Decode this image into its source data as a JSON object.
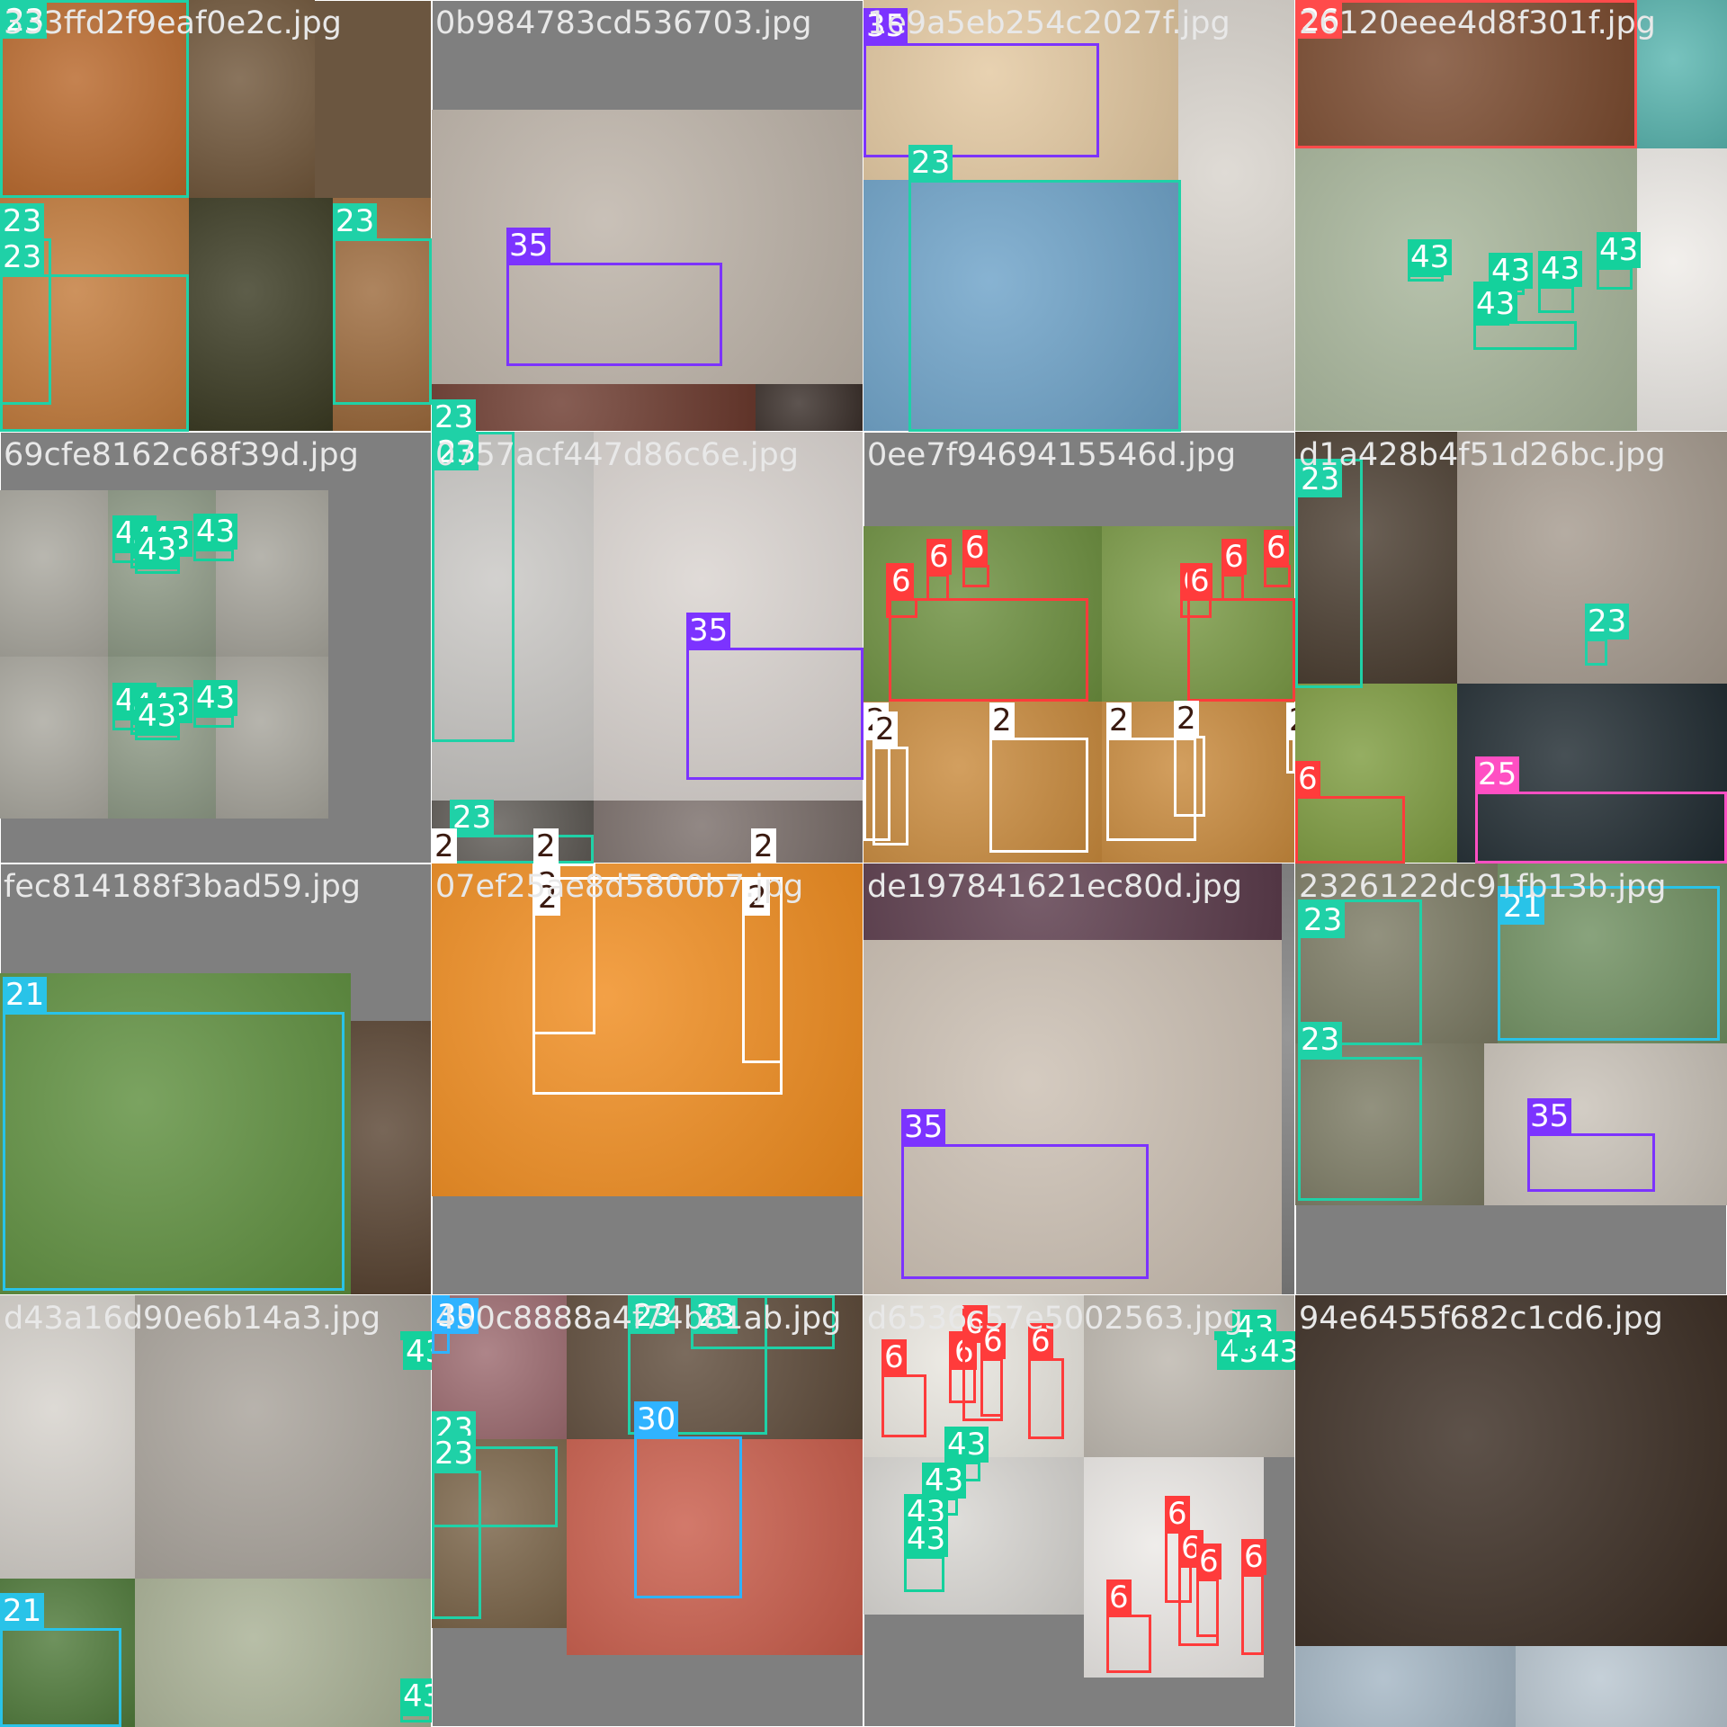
{
  "grid": {
    "rows": 4,
    "cols": 4
  },
  "class_colors": {
    "2": "#ffffff",
    "6": "#ff3b3b",
    "21": "#29c3e8",
    "23": "#1fd1a7",
    "25": "#ff4fc3",
    "26": "#ff4b4b",
    "30": "#2fb3ff",
    "35": "#7c33ff",
    "43": "#14d19c"
  },
  "tag_text_colors": {
    "2": "#3a1a10"
  },
  "tiles": [
    {
      "name": "333ffd2f9eaf0e2c.jpg",
      "bg": "#6b5640",
      "photos": [
        {
          "l": 0,
          "t": 0,
          "w": 210,
          "h": 220,
          "bg": "#b8672a"
        },
        {
          "l": 210,
          "t": 0,
          "w": 140,
          "h": 220,
          "bg": "#70563a"
        },
        {
          "l": 0,
          "t": 220,
          "w": 210,
          "h": 260,
          "bg": "#c27a3a"
        },
        {
          "l": 210,
          "t": 220,
          "w": 160,
          "h": 260,
          "bg": "#3a3a22"
        },
        {
          "l": 370,
          "t": 220,
          "w": 110,
          "h": 260,
          "bg": "#9c6a3c"
        }
      ],
      "boxes": [
        {
          "c": "23",
          "l": 0,
          "t": 0,
          "w": 210,
          "h": 220
        },
        {
          "c": "23",
          "l": 0,
          "t": 265,
          "w": 57,
          "h": 185
        },
        {
          "c": "23",
          "l": 0,
          "t": 305,
          "w": 210,
          "h": 175
        },
        {
          "c": "23",
          "l": 370,
          "t": 265,
          "w": 110,
          "h": 185
        }
      ]
    },
    {
      "name": "0b984783cd536703.jpg",
      "bg": "#7f7f7f",
      "photos": [
        {
          "l": 0,
          "t": 122,
          "w": 480,
          "h": 305,
          "bg": "#bdb3a8"
        },
        {
          "l": 0,
          "t": 427,
          "w": 360,
          "h": 53,
          "bg": "#6c3a2e"
        },
        {
          "l": 360,
          "t": 427,
          "w": 120,
          "h": 53,
          "bg": "#3a2f2a"
        }
      ],
      "boxes": [
        {
          "c": "35",
          "l": 83,
          "t": 292,
          "w": 240,
          "h": 115
        },
        {
          "c": "23",
          "l": 0,
          "t": 483,
          "w": 5,
          "h": 5
        }
      ]
    },
    {
      "name": "1e9a5eb254c2027f.jpg",
      "bg": "#d7d0c6",
      "photos": [
        {
          "l": 0,
          "t": 0,
          "w": 350,
          "h": 200,
          "bg": "#e3c8a0"
        },
        {
          "l": 0,
          "t": 200,
          "w": 350,
          "h": 280,
          "bg": "#6da2c8"
        },
        {
          "l": 350,
          "t": 0,
          "w": 130,
          "h": 480,
          "bg": "#d8d3cc"
        }
      ],
      "boxes": [
        {
          "c": "35",
          "l": 0,
          "t": 48,
          "w": 262,
          "h": 127
        },
        {
          "c": "23",
          "l": 50,
          "t": 200,
          "w": 303,
          "h": 280
        }
      ]
    },
    {
      "name": "26120eee4d8f301f.jpg",
      "bg": "#c9b7a0",
      "photos": [
        {
          "l": 0,
          "t": 0,
          "w": 380,
          "h": 165,
          "bg": "#7a4a2e"
        },
        {
          "l": 380,
          "t": 0,
          "w": 100,
          "h": 165,
          "bg": "#5ab6b0"
        },
        {
          "l": 0,
          "t": 165,
          "w": 380,
          "h": 315,
          "bg": "#a7b59a"
        },
        {
          "l": 380,
          "t": 165,
          "w": 100,
          "h": 315,
          "bg": "#efece8"
        }
      ],
      "boxes": [
        {
          "c": "26",
          "l": 0,
          "t": 0,
          "w": 380,
          "h": 165
        },
        {
          "c": "43",
          "l": 125,
          "t": 305,
          "w": 40,
          "h": 8
        },
        {
          "c": "43",
          "l": 215,
          "t": 320,
          "w": 40,
          "h": 8
        },
        {
          "c": "43",
          "l": 270,
          "t": 318,
          "w": 40,
          "h": 30
        },
        {
          "c": "43",
          "l": 335,
          "t": 297,
          "w": 40,
          "h": 25
        },
        {
          "c": "43",
          "l": 198,
          "t": 352,
          "w": 40,
          "h": 10
        },
        {
          "c": "43",
          "l": 198,
          "t": 357,
          "w": 115,
          "h": 32
        }
      ]
    },
    {
      "name": "69cfe8162c68f39d.jpg",
      "bg": "#7f7f7f",
      "photos": [
        {
          "l": 0,
          "t": 65,
          "w": 120,
          "h": 185,
          "bg": "#a9a79e"
        },
        {
          "l": 120,
          "t": 65,
          "w": 120,
          "h": 185,
          "bg": "#8e9a86"
        },
        {
          "l": 240,
          "t": 65,
          "w": 125,
          "h": 185,
          "bg": "#a6a49b"
        },
        {
          "l": 0,
          "t": 250,
          "w": 120,
          "h": 180,
          "bg": "#a9a79e"
        },
        {
          "l": 120,
          "t": 250,
          "w": 120,
          "h": 180,
          "bg": "#8e9a86"
        },
        {
          "l": 240,
          "t": 250,
          "w": 125,
          "h": 180,
          "bg": "#a6a49b"
        }
      ],
      "boxes": [
        {
          "c": "43",
          "l": 125,
          "t": 132,
          "w": 35,
          "h": 14
        },
        {
          "c": "43",
          "l": 145,
          "t": 138,
          "w": 35,
          "h": 14
        },
        {
          "c": "43",
          "l": 165,
          "t": 138,
          "w": 35,
          "h": 14
        },
        {
          "c": "43",
          "l": 150,
          "t": 150,
          "w": 50,
          "h": 8
        },
        {
          "c": "43",
          "l": 215,
          "t": 130,
          "w": 45,
          "h": 14
        },
        {
          "c": "43",
          "l": 125,
          "t": 318,
          "w": 35,
          "h": 14
        },
        {
          "c": "43",
          "l": 145,
          "t": 323,
          "w": 35,
          "h": 14
        },
        {
          "c": "43",
          "l": 165,
          "t": 323,
          "w": 35,
          "h": 14
        },
        {
          "c": "43",
          "l": 150,
          "t": 335,
          "w": 50,
          "h": 8
        },
        {
          "c": "43",
          "l": 215,
          "t": 315,
          "w": 45,
          "h": 14
        }
      ]
    },
    {
      "name": "0757acf447d86c6e.jpg",
      "bg": "#bbb8b4",
      "photos": [
        {
          "l": 0,
          "t": 0,
          "w": 180,
          "h": 410,
          "bg": "#c9c7c4"
        },
        {
          "l": 180,
          "t": 0,
          "w": 300,
          "h": 410,
          "bg": "#d9d3cf"
        },
        {
          "l": 0,
          "t": 410,
          "w": 180,
          "h": 70,
          "bg": "#5e5a55"
        },
        {
          "l": 180,
          "t": 410,
          "w": 300,
          "h": 70,
          "bg": "#7a6e6a"
        }
      ],
      "boxes": [
        {
          "c": "23",
          "l": 0,
          "t": 0,
          "w": 92,
          "h": 345
        },
        {
          "c": "35",
          "l": 283,
          "t": 240,
          "w": 197,
          "h": 147
        },
        {
          "c": "23",
          "l": 20,
          "t": 448,
          "w": 160,
          "h": 32
        },
        {
          "c": "2",
          "l": 0,
          "t": 480,
          "w": 5,
          "h": 5
        },
        {
          "c": "2",
          "l": 113,
          "t": 480,
          "w": 5,
          "h": 5
        },
        {
          "c": "2",
          "l": 355,
          "t": 480,
          "w": 5,
          "h": 5
        }
      ]
    },
    {
      "name": "0ee7f9469415546d.jpg",
      "bg": "#7f7f7f",
      "photos": [
        {
          "l": 0,
          "t": 105,
          "w": 265,
          "h": 195,
          "bg": "#6c8f3e"
        },
        {
          "l": 265,
          "t": 105,
          "w": 215,
          "h": 195,
          "bg": "#7a9a45"
        },
        {
          "l": 0,
          "t": 300,
          "w": 265,
          "h": 180,
          "bg": "#c98a3c"
        },
        {
          "l": 265,
          "t": 300,
          "w": 215,
          "h": 180,
          "bg": "#c98a3c"
        }
      ],
      "boxes": [
        {
          "c": "6",
          "l": 25,
          "t": 185,
          "w": 35,
          "h": 22
        },
        {
          "c": "6",
          "l": 70,
          "t": 158,
          "w": 25,
          "h": 30
        },
        {
          "c": "6",
          "l": 110,
          "t": 148,
          "w": 30,
          "h": 25
        },
        {
          "c": "6",
          "l": 28,
          "t": 185,
          "w": 222,
          "h": 115
        },
        {
          "c": "6",
          "l": 352,
          "t": 185,
          "w": 35,
          "h": 22
        },
        {
          "c": "6",
          "l": 398,
          "t": 158,
          "w": 25,
          "h": 30
        },
        {
          "c": "6",
          "l": 445,
          "t": 148,
          "w": 30,
          "h": 25
        },
        {
          "c": "6",
          "l": 360,
          "t": 185,
          "w": 120,
          "h": 115
        },
        {
          "c": "2",
          "l": 0,
          "t": 340,
          "w": 30,
          "h": 115
        },
        {
          "c": "2",
          "l": 10,
          "t": 350,
          "w": 40,
          "h": 110
        },
        {
          "c": "2",
          "l": 140,
          "t": 340,
          "w": 110,
          "h": 128
        },
        {
          "c": "2",
          "l": 270,
          "t": 340,
          "w": 100,
          "h": 115
        },
        {
          "c": "2",
          "l": 345,
          "t": 338,
          "w": 35,
          "h": 90
        },
        {
          "c": "2",
          "l": 470,
          "t": 340,
          "w": 10,
          "h": 40
        }
      ]
    },
    {
      "name": "d1a428b4f51d26bc.jpg",
      "bg": "#3a3a3a",
      "photos": [
        {
          "l": 0,
          "t": 0,
          "w": 180,
          "h": 280,
          "bg": "#4a3d30"
        },
        {
          "l": 180,
          "t": 0,
          "w": 300,
          "h": 280,
          "bg": "#a59a8e"
        },
        {
          "l": 0,
          "t": 280,
          "w": 180,
          "h": 200,
          "bg": "#7e9c40"
        },
        {
          "l": 180,
          "t": 280,
          "w": 300,
          "h": 200,
          "bg": "#1f2a30"
        }
      ],
      "boxes": [
        {
          "c": "23",
          "l": 0,
          "t": 30,
          "w": 75,
          "h": 255
        },
        {
          "c": "23",
          "l": 322,
          "t": 230,
          "w": 25,
          "h": 30
        },
        {
          "c": "6",
          "l": 0,
          "t": 405,
          "w": 122,
          "h": 75
        },
        {
          "c": "25",
          "l": 200,
          "t": 400,
          "w": 280,
          "h": 80
        }
      ]
    },
    {
      "name": "fec814188f3bad59.jpg",
      "bg": "#7f7f7f",
      "photos": [
        {
          "l": 0,
          "t": 122,
          "w": 390,
          "h": 358,
          "bg": "#5e8f3e"
        },
        {
          "l": 390,
          "t": 175,
          "w": 90,
          "h": 305,
          "bg": "#5a4533"
        }
      ],
      "boxes": [
        {
          "c": "21",
          "l": 3,
          "t": 165,
          "w": 380,
          "h": 310
        }
      ]
    },
    {
      "name": "07ef25ae8d5800b7.jpg",
      "bg": "#7f7f7f",
      "photos": [
        {
          "l": 0,
          "t": 0,
          "w": 480,
          "h": 370,
          "bg": "#f08c1e"
        }
      ],
      "boxes": [
        {
          "c": "2",
          "l": 112,
          "t": 0,
          "w": 70,
          "h": 190
        },
        {
          "c": "2",
          "l": 112,
          "t": 15,
          "w": 278,
          "h": 242
        },
        {
          "c": "2",
          "l": 345,
          "t": 15,
          "w": 45,
          "h": 207
        }
      ]
    },
    {
      "name": "de197841621ec80d.jpg",
      "bg": "#bdb1a6",
      "photos": [
        {
          "l": 0,
          "t": 0,
          "w": 480,
          "h": 85,
          "bg": "#5a3a4a"
        },
        {
          "l": 0,
          "t": 85,
          "w": 465,
          "h": 395,
          "bg": "#cbbfb2"
        },
        {
          "l": 465,
          "t": 0,
          "w": 15,
          "h": 480,
          "bg": "#7f7f7f"
        }
      ],
      "boxes": [
        {
          "c": "35",
          "l": 42,
          "t": 312,
          "w": 275,
          "h": 150
        }
      ]
    },
    {
      "name": "2326122dc91fb13b.jpg",
      "bg": "#7f7f7f",
      "photos": [
        {
          "l": 0,
          "t": 0,
          "w": 225,
          "h": 200,
          "bg": "#7b7a63"
        },
        {
          "l": 225,
          "t": 0,
          "w": 255,
          "h": 200,
          "bg": "#6f8f60"
        },
        {
          "l": 0,
          "t": 200,
          "w": 210,
          "h": 180,
          "bg": "#7b7a63"
        },
        {
          "l": 210,
          "t": 200,
          "w": 270,
          "h": 180,
          "bg": "#c9c2b8"
        }
      ],
      "boxes": [
        {
          "c": "23",
          "l": 3,
          "t": 40,
          "w": 138,
          "h": 162
        },
        {
          "c": "21",
          "l": 225,
          "t": 25,
          "w": 247,
          "h": 172
        },
        {
          "c": "23",
          "l": 3,
          "t": 215,
          "w": 138,
          "h": 160
        },
        {
          "c": "35",
          "l": 258,
          "t": 300,
          "w": 142,
          "h": 65
        }
      ]
    },
    {
      "name": "d43a16d90e6b14a3.jpg",
      "bg": "#7f7f7f",
      "photos": [
        {
          "l": 0,
          "t": 0,
          "w": 150,
          "h": 315,
          "bg": "#d6d2cc"
        },
        {
          "l": 150,
          "t": 0,
          "w": 330,
          "h": 315,
          "bg": "#a8a29a"
        },
        {
          "l": 0,
          "t": 315,
          "w": 150,
          "h": 165,
          "bg": "#4f7a3a"
        },
        {
          "l": 150,
          "t": 315,
          "w": 330,
          "h": 165,
          "bg": "#a8b094"
        }
      ],
      "boxes": [
        {
          "c": "43",
          "l": 445,
          "t": 40,
          "w": 35,
          "h": 10
        },
        {
          "c": "21",
          "l": 0,
          "t": 370,
          "w": 135,
          "h": 110
        },
        {
          "c": "43",
          "l": 445,
          "t": 465,
          "w": 35,
          "h": 10
        }
      ]
    },
    {
      "name": "450c8888a4f74b81ab.jpg",
      "bg": "#7f7f7f",
      "photos": [
        {
          "l": 0,
          "t": 0,
          "w": 150,
          "h": 160,
          "bg": "#9c6a6f"
        },
        {
          "l": 150,
          "t": 0,
          "w": 330,
          "h": 160,
          "bg": "#5e4b3a"
        },
        {
          "l": 0,
          "t": 160,
          "w": 150,
          "h": 210,
          "bg": "#7a6448"
        },
        {
          "l": 150,
          "t": 160,
          "w": 330,
          "h": 240,
          "bg": "#c95c4a"
        }
      ],
      "boxes": [
        {
          "c": "30",
          "l": 0,
          "t": 0,
          "w": 20,
          "h": 65
        },
        {
          "c": "23",
          "l": 218,
          "t": 0,
          "w": 155,
          "h": 155
        },
        {
          "c": "23",
          "l": 288,
          "t": 0,
          "w": 160,
          "h": 60
        },
        {
          "c": "30",
          "l": 225,
          "t": 157,
          "w": 120,
          "h": 180
        },
        {
          "c": "23",
          "l": 0,
          "t": 168,
          "w": 140,
          "h": 90
        },
        {
          "c": "23",
          "l": 0,
          "t": 195,
          "w": 55,
          "h": 165
        }
      ]
    },
    {
      "name": "d6536c57e5002563.jpg",
      "bg": "#7f7f7f",
      "photos": [
        {
          "l": 0,
          "t": 0,
          "w": 245,
          "h": 180,
          "bg": "#e9e6df"
        },
        {
          "l": 245,
          "t": 0,
          "w": 235,
          "h": 180,
          "bg": "#bcb6ad"
        },
        {
          "l": 0,
          "t": 180,
          "w": 245,
          "h": 175,
          "bg": "#d8d6d2"
        },
        {
          "l": 245,
          "t": 180,
          "w": 200,
          "h": 245,
          "bg": "#ece9e6"
        }
      ],
      "boxes": [
        {
          "c": "6",
          "l": 20,
          "t": 88,
          "w": 50,
          "h": 70
        },
        {
          "c": "6",
          "l": 95,
          "t": 40,
          "w": 30,
          "h": 80
        },
        {
          "c": "6",
          "l": 110,
          "t": 50,
          "w": 45,
          "h": 90
        },
        {
          "c": "6",
          "l": 130,
          "t": 70,
          "w": 25,
          "h": 65
        },
        {
          "c": "6",
          "l": 183,
          "t": 70,
          "w": 40,
          "h": 90
        },
        {
          "c": "43",
          "l": 390,
          "t": 40,
          "w": 40,
          "h": 10
        },
        {
          "c": "43",
          "l": 410,
          "t": 55,
          "w": 20,
          "h": 10
        },
        {
          "c": "43",
          "l": 435,
          "t": 40,
          "w": 45,
          "h": 10
        },
        {
          "c": "43",
          "l": 90,
          "t": 185,
          "w": 40,
          "h": 22
        },
        {
          "c": "43",
          "l": 65,
          "t": 225,
          "w": 40,
          "h": 20
        },
        {
          "c": "43",
          "l": 45,
          "t": 260,
          "w": 35,
          "h": 20
        },
        {
          "c": "43",
          "l": 45,
          "t": 290,
          "w": 45,
          "h": 40
        },
        {
          "c": "6",
          "l": 270,
          "t": 355,
          "w": 50,
          "h": 65
        },
        {
          "c": "6",
          "l": 335,
          "t": 262,
          "w": 30,
          "h": 80
        },
        {
          "c": "6",
          "l": 350,
          "t": 300,
          "w": 45,
          "h": 90
        },
        {
          "c": "6",
          "l": 370,
          "t": 315,
          "w": 25,
          "h": 65
        },
        {
          "c": "6",
          "l": 420,
          "t": 310,
          "w": 25,
          "h": 90
        }
      ]
    },
    {
      "name": "94e6455f682c1cd6.jpg",
      "bg": "#2e211a",
      "photos": [
        {
          "l": 0,
          "t": 0,
          "w": 480,
          "h": 390,
          "bg": "#3a2c22"
        },
        {
          "l": 0,
          "t": 390,
          "w": 245,
          "h": 90,
          "bg": "#a4b6c4"
        },
        {
          "l": 245,
          "t": 390,
          "w": 235,
          "h": 90,
          "bg": "#b9c6d0"
        }
      ],
      "boxes": []
    }
  ]
}
